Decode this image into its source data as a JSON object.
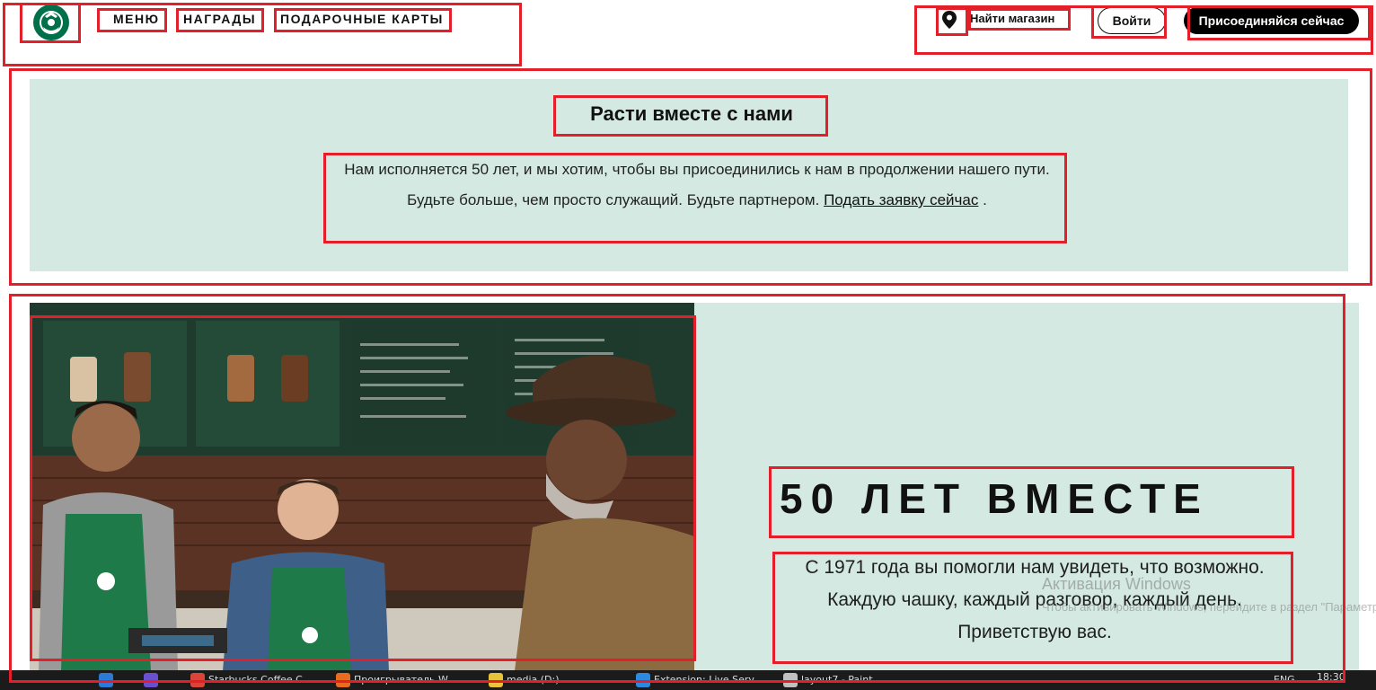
{
  "header": {
    "nav": [
      "МЕНЮ",
      "НАГРАДЫ",
      "ПОДАРОЧНЫЕ КАРТЫ"
    ],
    "find_store": "Найти магазин",
    "login": "Войти",
    "join": "Присоединяйся сейчас"
  },
  "banner": {
    "title": "Расти вместе с нами",
    "text": "Нам исполняется 50 лет, и мы хотим, чтобы вы присоединились к нам в продолжении нашего пути. Будьте больше, чем просто служащий. Будьте партнером.",
    "link": "Подать заявку сейчас",
    "tail": "."
  },
  "feature": {
    "title": "50 ЛЕТ ВМЕСТЕ",
    "text": "С 1971 года вы помогли нам увидеть, что возможно. Каждую чашку, каждый разговор, каждый день. Приветствую вас."
  },
  "watermark": {
    "title": "Активация Windows",
    "subtitle": "Чтобы активировать Windows, перейдите в раздел \"Параметры\"."
  },
  "taskbar": {
    "items": [
      "Starbucks Coffee C...",
      "Проигрыватель W...",
      "media (D:)",
      "Extension: Live Serv...",
      "layout7 - Paint"
    ],
    "lang": "ENG",
    "time": "18:30"
  },
  "colors": {
    "mint": "#d4e9e2",
    "siren_green": "#00704a",
    "outline_red": "#e3202a"
  }
}
